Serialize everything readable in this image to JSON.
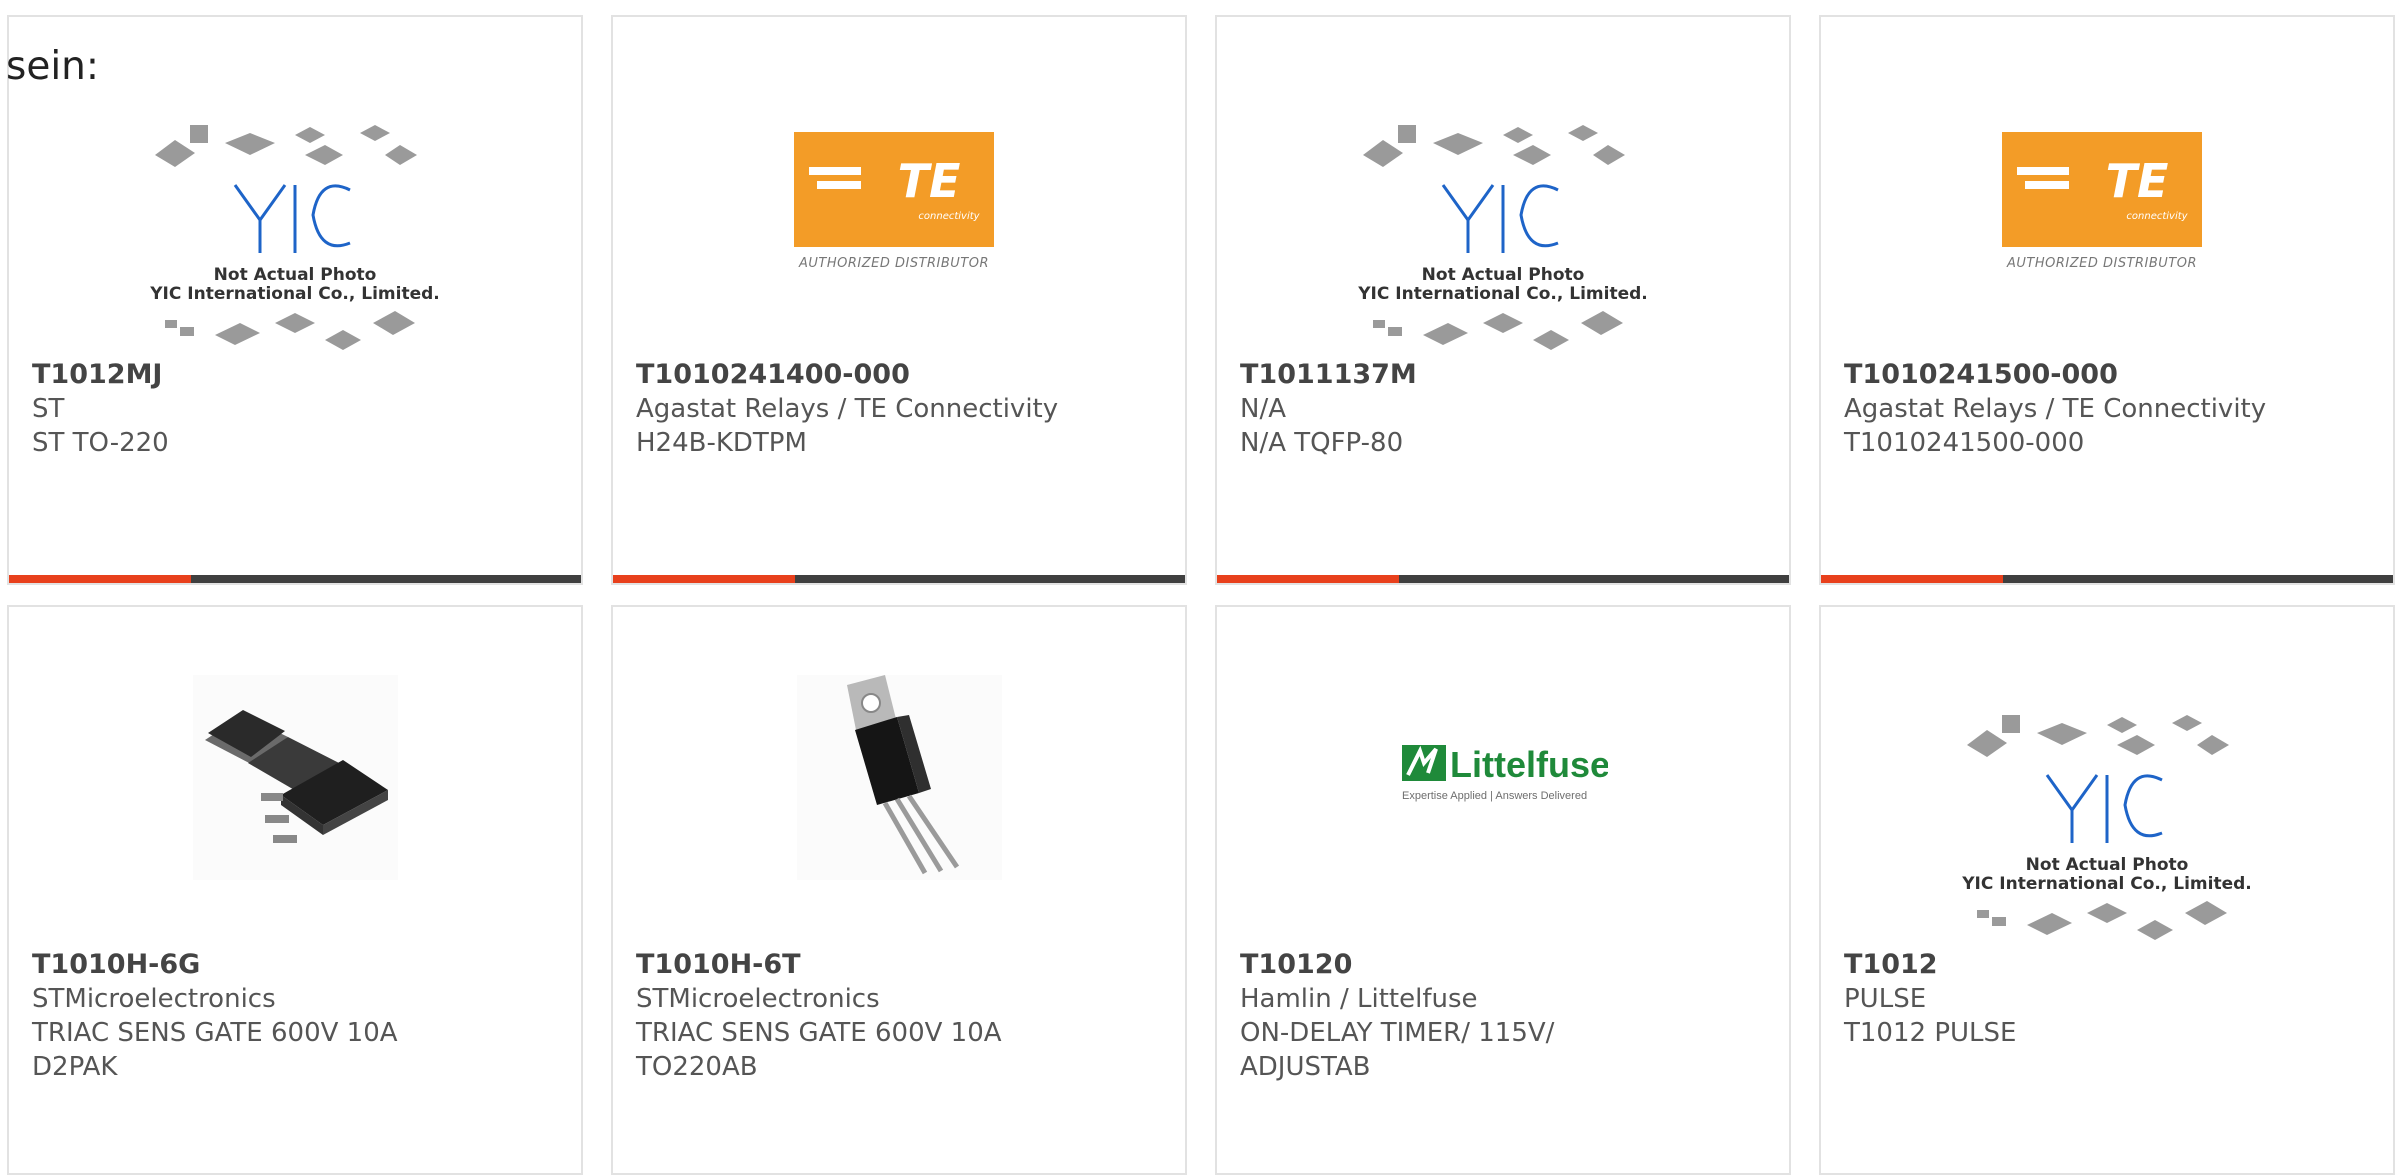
{
  "lead_text": "sein:",
  "accent": "#e8401c",
  "bar_dark": "#3f3f3f",
  "products": [
    {
      "part": "T1012MJ",
      "maker": "ST",
      "desc": "ST TO-220",
      "image": "yic-placeholder",
      "caption1": "Not Actual Photo",
      "caption2": "YIC International Co., Limited."
    },
    {
      "part": "T1010241400-000",
      "maker": "Agastat Relays / TE Connectivity",
      "desc": "H24B-KDTPM",
      "image": "te-logo",
      "logo_text": "TE",
      "logo_sub": "connectivity",
      "logo_caption": "AUTHORIZED DISTRIBUTOR"
    },
    {
      "part": "T1011137M",
      "maker": "N/A",
      "desc": "N/A TQFP-80",
      "image": "yic-placeholder",
      "caption1": "Not Actual Photo",
      "caption2": "YIC International Co., Limited."
    },
    {
      "part": "T1010241500-000",
      "maker": "Agastat Relays / TE Connectivity",
      "desc": "T1010241500-000",
      "image": "te-logo",
      "logo_text": "TE",
      "logo_sub": "connectivity",
      "logo_caption": "AUTHORIZED DISTRIBUTOR"
    },
    {
      "part": "T1010H-6G",
      "maker": "STMicroelectronics",
      "desc": "TRIAC SENS GATE 600V 10A",
      "desc2": "D2PAK",
      "image": "d2pak-photo"
    },
    {
      "part": "T1010H-6T",
      "maker": "STMicroelectronics",
      "desc": "TRIAC SENS GATE 600V 10A",
      "desc2": "TO220AB",
      "image": "to220-photo"
    },
    {
      "part": "T10120",
      "maker": "Hamlin / Littelfuse",
      "desc": "ON-DELAY TIMER/ 115V/",
      "desc2": "ADJUSTAB",
      "image": "littelfuse-logo",
      "logo_text": "Littelfuse",
      "logo_sub": "Expertise Applied | Answers Delivered"
    },
    {
      "part": "T1012",
      "maker": "PULSE",
      "desc": "T1012 PULSE",
      "image": "yic-placeholder",
      "caption1": "Not Actual Photo",
      "caption2": "YIC International Co., Limited."
    }
  ]
}
